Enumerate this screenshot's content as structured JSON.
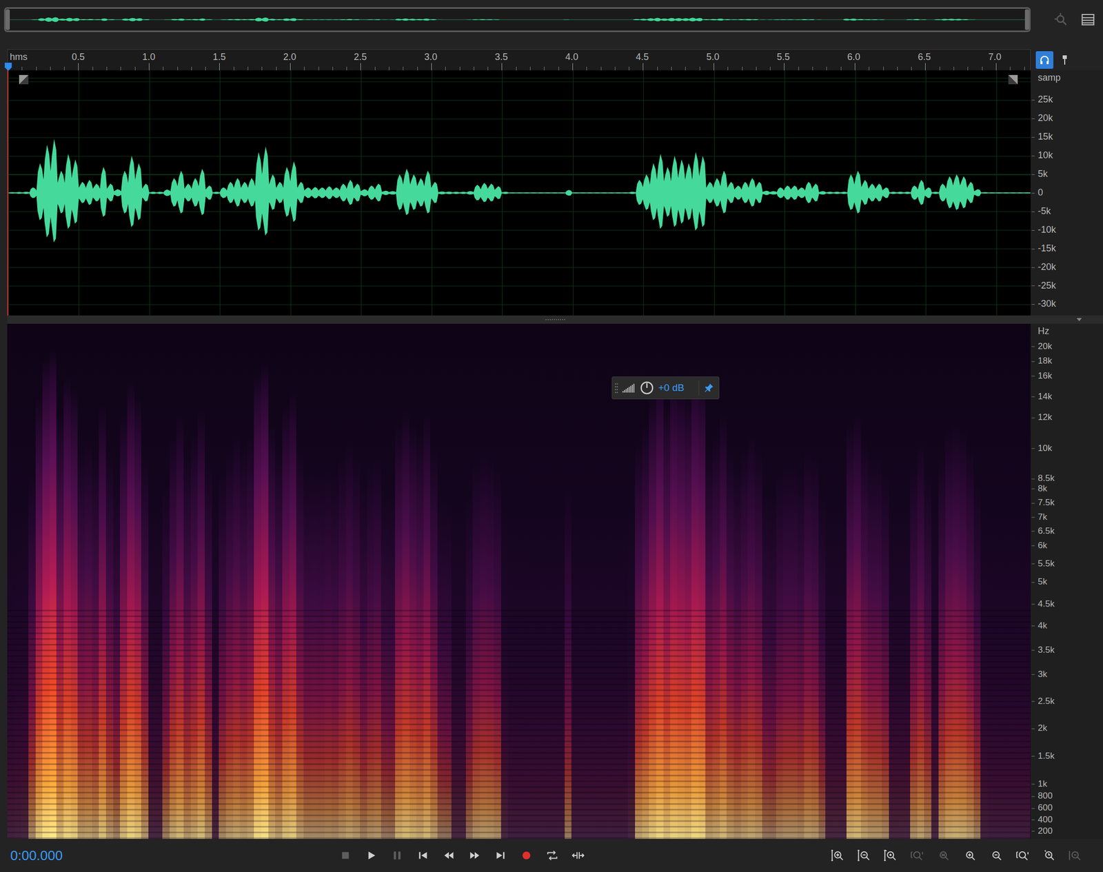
{
  "ruler": {
    "unit": "hms",
    "ticks": [
      "0.5",
      "1.0",
      "1.5",
      "2.0",
      "2.5",
      "3.0",
      "3.5",
      "4.0",
      "4.5",
      "5.0",
      "5.5",
      "6.0",
      "6.5",
      "7.0"
    ],
    "monitor_input": {
      "selected": true
    }
  },
  "waveform": {
    "unit": "samp",
    "ticks": [
      {
        "label": "25k",
        "value": 25000
      },
      {
        "label": "20k",
        "value": 20000
      },
      {
        "label": "15k",
        "value": 15000
      },
      {
        "label": "10k",
        "value": 10000
      },
      {
        "label": "5k",
        "value": 5000
      },
      {
        "label": "0",
        "value": 0
      },
      {
        "label": "-5k",
        "value": -5000
      },
      {
        "label": "-10k",
        "value": -10000
      },
      {
        "label": "-15k",
        "value": -15000
      },
      {
        "label": "-20k",
        "value": -20000
      },
      {
        "label": "-25k",
        "value": -25000
      },
      {
        "label": "-30k",
        "value": -30000
      }
    ],
    "values": [
      200,
      250,
      300,
      1500,
      8000,
      13000,
      14500,
      6000,
      10500,
      9000,
      3000,
      3500,
      2500,
      7000,
      2500,
      1000,
      6000,
      10000,
      8000,
      2500,
      300,
      300,
      900,
      4000,
      6000,
      2500,
      4000,
      6500,
      2000,
      300,
      1500,
      3000,
      4000,
      3000,
      4000,
      11000,
      12500,
      5000,
      3000,
      7000,
      8500,
      3000,
      1500,
      1600,
      1500,
      1800,
      1500,
      2500,
      3500,
      2500,
      1000,
      2000,
      2500,
      600,
      500,
      5000,
      6500,
      5000,
      4000,
      6000,
      3000,
      400,
      350,
      300,
      300,
      500,
      2200,
      2700,
      2500,
      1800,
      300,
      150,
      150,
      150,
      150,
      150,
      150,
      150,
      150,
      800,
      150,
      150,
      150,
      150,
      150,
      150,
      150,
      150,
      300,
      3500,
      5000,
      8000,
      10500,
      7000,
      10000,
      9000,
      8000,
      11000,
      10000,
      3000,
      4000,
      6000,
      3000,
      2000,
      3000,
      4000,
      3000,
      600,
      500,
      1500,
      2000,
      2000,
      1500,
      3000,
      2500,
      500,
      300,
      300,
      300,
      5000,
      6000,
      3500,
      2500,
      2500,
      1500,
      300,
      300,
      300,
      2000,
      3500,
      1500,
      300,
      2500,
      4500,
      5000,
      4500,
      3000,
      1000,
      200,
      150,
      150,
      150,
      150,
      150,
      150
    ]
  },
  "spectrogram": {
    "unit": "Hz",
    "ticks": [
      {
        "label": "20k",
        "hz": 20000
      },
      {
        "label": "18k",
        "hz": 18000
      },
      {
        "label": "16k",
        "hz": 16000
      },
      {
        "label": "14k",
        "hz": 14000
      },
      {
        "label": "12k",
        "hz": 12000
      },
      {
        "label": "10k",
        "hz": 10000
      },
      {
        "label": "8.5k",
        "hz": 8500
      },
      {
        "label": "8k",
        "hz": 8000
      },
      {
        "label": "7.5k",
        "hz": 7500
      },
      {
        "label": "7k",
        "hz": 7000
      },
      {
        "label": "6.5k",
        "hz": 6500
      },
      {
        "label": "6k",
        "hz": 6000
      },
      {
        "label": "5.5k",
        "hz": 5500
      },
      {
        "label": "5k",
        "hz": 5000
      },
      {
        "label": "4.5k",
        "hz": 4500
      },
      {
        "label": "4k",
        "hz": 4000
      },
      {
        "label": "3.5k",
        "hz": 3500
      },
      {
        "label": "3k",
        "hz": 3000
      },
      {
        "label": "2.5k",
        "hz": 2500
      },
      {
        "label": "2k",
        "hz": 2000
      },
      {
        "label": "1.5k",
        "hz": 1500
      },
      {
        "label": "1k",
        "hz": 1000
      },
      {
        "label": "800",
        "hz": 800
      },
      {
        "label": "600",
        "hz": 600
      },
      {
        "label": "400",
        "hz": 400
      },
      {
        "label": "200",
        "hz": 200
      }
    ]
  },
  "hud": {
    "gain": "+0 dB",
    "pinned": true
  },
  "transport": {
    "time": "0:00.000",
    "buttons": [
      {
        "kind": "stop",
        "disabled": true
      },
      {
        "kind": "play",
        "disabled": false
      },
      {
        "kind": "pause",
        "disabled": true
      },
      {
        "kind": "prev",
        "disabled": false
      },
      {
        "kind": "rewind",
        "disabled": false
      },
      {
        "kind": "forward",
        "disabled": false
      },
      {
        "kind": "next",
        "disabled": false
      },
      {
        "kind": "record",
        "disabled": false
      },
      {
        "kind": "loop",
        "disabled": false
      },
      {
        "kind": "skip",
        "disabled": false
      }
    ]
  },
  "zoom": {
    "buttons": [
      {
        "kind": "amp-in",
        "disabled": false
      },
      {
        "kind": "amp-out",
        "disabled": false
      },
      {
        "kind": "amp-reset",
        "disabled": false
      },
      {
        "kind": "out-full",
        "disabled": true
      },
      {
        "kind": "fit",
        "disabled": true
      },
      {
        "kind": "in",
        "disabled": false
      },
      {
        "kind": "out",
        "disabled": false
      },
      {
        "kind": "full",
        "disabled": false
      },
      {
        "kind": "playhead",
        "disabled": false
      },
      {
        "kind": "selection",
        "disabled": true
      }
    ]
  }
}
